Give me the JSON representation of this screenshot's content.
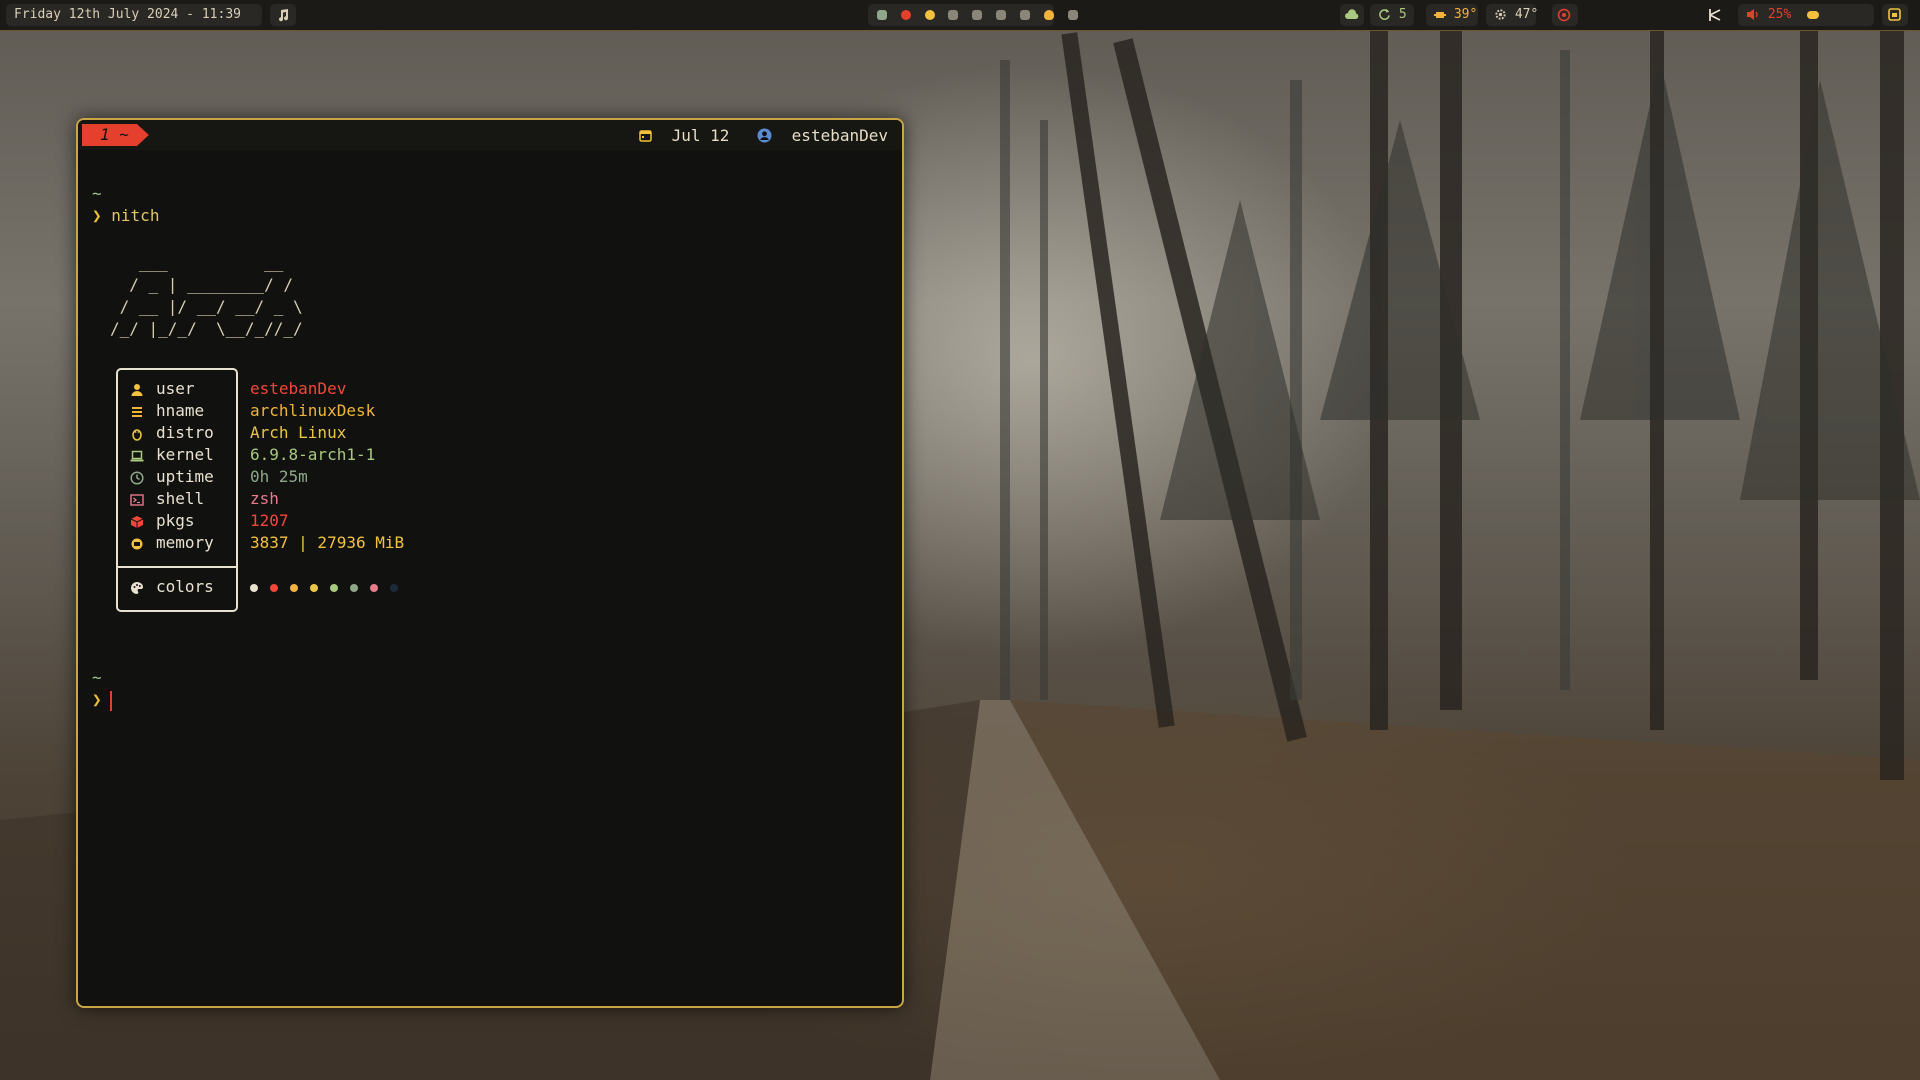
{
  "topbar": {
    "datetime": "Friday 12th July 2024 - 11:39",
    "music_icon": "music-note-icon",
    "workspaces": [
      "ghost-icon",
      "red-dot-icon",
      "pacman-icon",
      "ghost-icon",
      "ghost-icon",
      "ghost-icon",
      "ghost-icon",
      "flame-icon",
      "cat-icon"
    ],
    "cloud_icon": "cloud-icon",
    "updates": "5",
    "cpu_temp": "39°",
    "gpu_temp": "47°",
    "record_icon": "record-icon",
    "network_icon": "network-icon",
    "volume": "25%",
    "power_icon": "power-icon"
  },
  "terminal": {
    "tab_label": "1 ~",
    "date_label": "Jul 12",
    "user_label": "estebanDev",
    "prompt_dir": "~",
    "prompt_symbol": "❯",
    "command": "nitch",
    "ascii_art": [
      "   ___          __",
      "  / _ | ________/ /",
      " / __ |/ __/ __/ _ \\",
      "/_/ |_/_/  \\__/_//_/"
    ],
    "info": [
      {
        "key": "user",
        "value": "estebanDev",
        "icon": "user-icon",
        "color": "#f4473a",
        "icon_color": "#f2c23f"
      },
      {
        "key": "hname",
        "value": "archlinuxDesk",
        "icon": "hostname-icon",
        "color": "#f2b33d",
        "icon_color": "#f2b33d"
      },
      {
        "key": "distro",
        "value": "Arch Linux",
        "icon": "linux-icon",
        "color": "#e9c648",
        "icon_color": "#e9c648"
      },
      {
        "key": "kernel",
        "value": "6.9.8-arch1-1",
        "icon": "laptop-icon",
        "color": "#a8c97f",
        "icon_color": "#a8c97f"
      },
      {
        "key": "uptime",
        "value": "0h 25m",
        "icon": "clock-icon",
        "color": "#8fa889",
        "icon_color": "#8fa889"
      },
      {
        "key": "shell",
        "value": "zsh",
        "icon": "terminal-icon",
        "color": "#e87b8c",
        "icon_color": "#e87b8c"
      },
      {
        "key": "pkgs",
        "value": "1207",
        "icon": "package-icon",
        "color": "#f4473a",
        "icon_color": "#f4473a"
      },
      {
        "key": "memory",
        "value": "3837 | 27936 MiB",
        "icon": "memory-icon",
        "color": "#f2c23f",
        "icon_color": "#f2c23f"
      }
    ],
    "colors_label": "colors",
    "colors_icon": "palette-icon",
    "palette": [
      "#e9e1cf",
      "#f4473a",
      "#f2b33d",
      "#e9c648",
      "#a8c97f",
      "#8fa889",
      "#e87b8c",
      "#1d2a3a"
    ]
  }
}
